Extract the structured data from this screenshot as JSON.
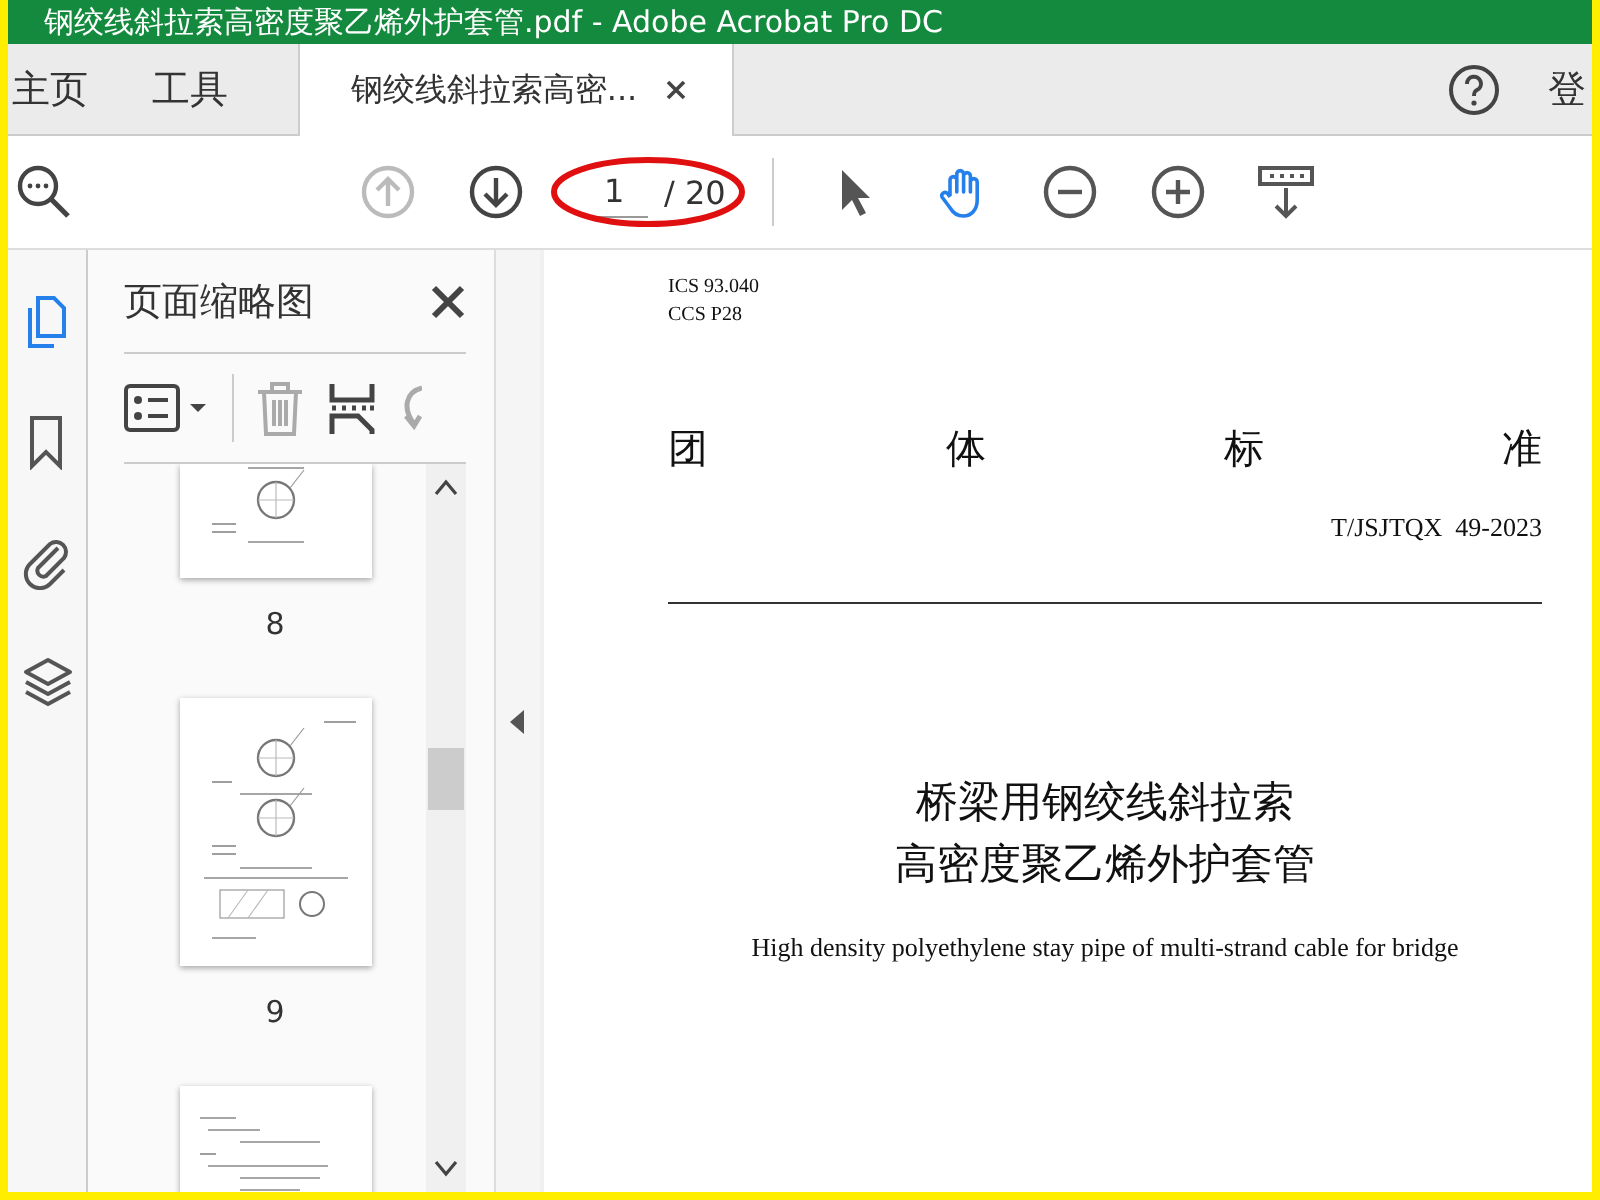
{
  "window": {
    "title": "钢绞线斜拉索高密度聚乙烯外护套管.pdf - Adobe Acrobat Pro DC"
  },
  "nav_tabs": [
    {
      "label": "主页",
      "selected": false
    },
    {
      "label": "工具",
      "selected": false
    },
    {
      "label": "钢绞线斜拉索高密...",
      "selected": true,
      "kind": "document"
    }
  ],
  "sign_in": "登",
  "toolbar": {
    "prev_disabled": true,
    "page_current": "1",
    "page_total": "/ 20",
    "tools": [
      {
        "kind": "select",
        "selected": false
      },
      {
        "kind": "hand",
        "selected": true
      },
      {
        "kind": "zoom-out",
        "selected": false
      },
      {
        "kind": "zoom-in",
        "selected": false
      },
      {
        "kind": "marquee",
        "selected": false
      }
    ]
  },
  "rail": [
    {
      "kind": "pages",
      "selected": true
    },
    {
      "kind": "bookmarks",
      "selected": false
    },
    {
      "kind": "attachments",
      "selected": false
    },
    {
      "kind": "layers",
      "selected": false
    }
  ],
  "thumbnail_panel": {
    "title": "页面缩略图",
    "thumbnails": [
      {
        "kind": "top-cut",
        "label": "8"
      },
      {
        "kind": "full",
        "label": "9"
      },
      {
        "kind": "bottom-cut"
      }
    ]
  },
  "document": {
    "ics": "ICS 93.040",
    "ccs": "CCS P28",
    "heading": [
      "团",
      "体",
      "标",
      "准"
    ],
    "code": "T/JSJTQX  49-2023",
    "title_lines": [
      "桥梁用钢绞线斜拉索",
      "高密度聚乙烯外护套管"
    ],
    "english_title": "High density polyethylene stay pipe of multi-strand cable for bridge"
  }
}
